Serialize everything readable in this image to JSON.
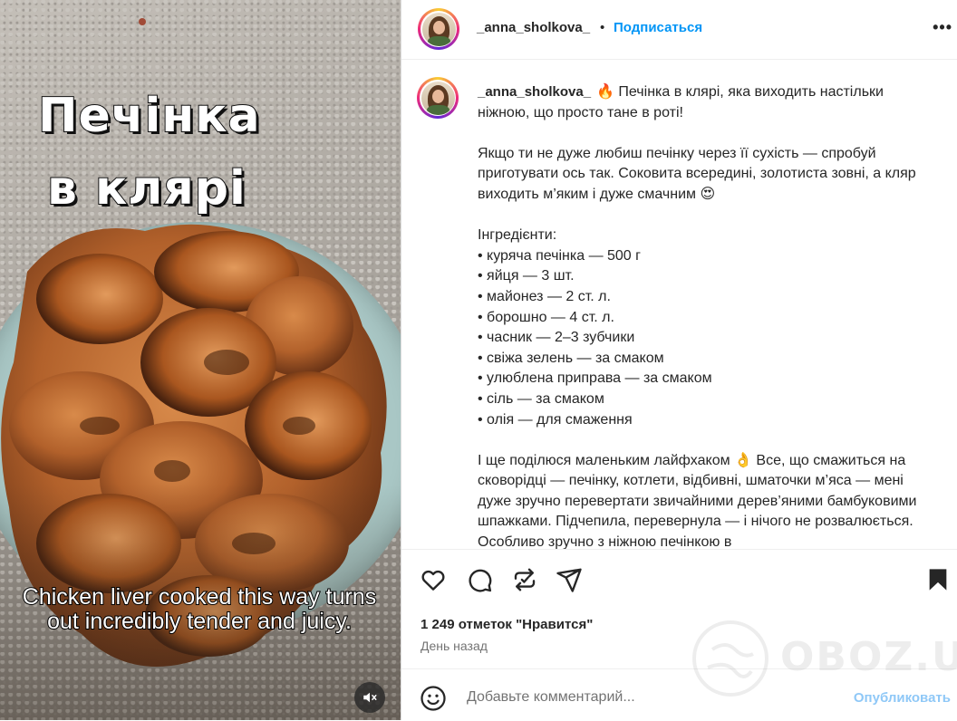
{
  "media": {
    "overlay_title_line1": "Печінка",
    "overlay_title_line2": "в клярі",
    "subtitle": "Chicken liver cooked this way turns out incredibly tender and juicy.",
    "mute_icon": "speaker-muted-icon"
  },
  "header": {
    "username": "_anna_sholkova_",
    "separator": "•",
    "follow_label": "Подписаться",
    "more_label": "•••"
  },
  "caption": {
    "username": "_anna_sholkova_",
    "text": "🔥 Печінка в клярі, яка виходить настільки ніжною, що просто тане в роті!\n\nЯкщо ти не дуже любиш печінку через її сухість — спробуй приготувати ось так. Соковита всередині, золотиста зовні, а кляр виходить м’яким і дуже смачним 😍\n\nІнгредієнти:\n• куряча печінка — 500 г\n• яйця — 3 шт.\n• майонез — 2 ст. л.\n• борошно — 4 ст. л.\n• часник — 2–3 зубчики\n• свіжа зелень — за смаком\n• улюблена приправа — за смаком\n• сіль — за смаком\n• олія — для смаження\n\nІ ще поділюся маленьким лайфхаком 👌 Все, що смажиться на сковорідці — печінку, котлети, відбивні, шматочки м’яса — мені дуже зручно перевертати звичайними дерев’яними бамбуковими шпажками. Підчепила, перевернула — і нічого не розвалюється. Особливо зручно з ніжною печінкою в"
  },
  "actions": {
    "likes": "1 249 отметок \"Нравится\"",
    "time": "День назад"
  },
  "comment": {
    "placeholder": "Добавьте комментарий...",
    "publish_label": "Опубликовать"
  },
  "watermark": {
    "text": "OBOZ.UA"
  },
  "colors": {
    "accent": "#0095f6",
    "publish_disabled": "#8fc8f7",
    "muted_text": "#737373"
  }
}
